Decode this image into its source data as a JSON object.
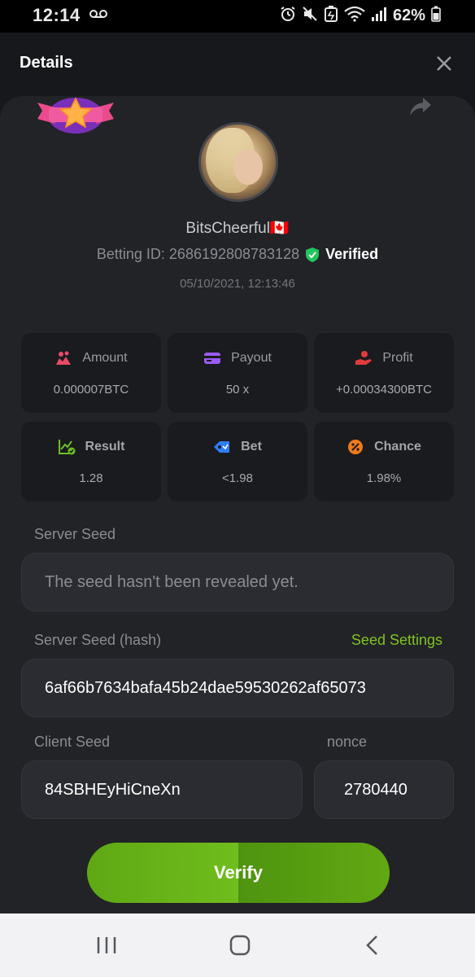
{
  "status_bar": {
    "time": "12:14",
    "voicemail_icon": "voicemail-icon",
    "battery_percent": "62%",
    "icons": [
      "alarm-icon",
      "mute-icon",
      "saver-icon",
      "wifi-icon",
      "signal-icon",
      "battery-icon"
    ]
  },
  "header": {
    "title": "Details",
    "close_icon": "close-icon"
  },
  "profile": {
    "username": "BitsCheerful🇨🇦",
    "betting_id_label": "Betting ID: 2686192808783128",
    "verified_label": "Verified",
    "datetime": "05/10/2021, 12:13:46"
  },
  "stats": [
    {
      "label": "Amount",
      "value": "0.000007BTC",
      "icon": "coins-icon",
      "color": "#e84a66"
    },
    {
      "label": "Payout",
      "value": "50 x",
      "icon": "card-icon",
      "color": "#9b5cf5"
    },
    {
      "label": "Profit",
      "value": "+0.00034300BTC",
      "icon": "hand-coin-icon",
      "color": "#e23b3b"
    },
    {
      "label": "Result",
      "value": "1.28",
      "icon": "chart-check-icon",
      "color": "#6cbf27"
    },
    {
      "label": "Bet",
      "value": "<1.98",
      "icon": "tag-icon",
      "color": "#2f7df5"
    },
    {
      "label": "Chance",
      "value": "1.98%",
      "icon": "percent-icon",
      "color": "#f07a1a"
    }
  ],
  "server_seed": {
    "label": "Server Seed",
    "value": "The seed hasn't been revealed yet."
  },
  "server_seed_hash": {
    "label": "Server Seed (hash)",
    "link": "Seed Settings",
    "value": "6af66b7634bafa45b24dae59530262af65073"
  },
  "client_seed": {
    "label": "Client Seed",
    "value": "84SBHEyHiCneXn"
  },
  "nonce": {
    "label": "nonce",
    "value": "2780440"
  },
  "verify_button": "Verify",
  "colors": {
    "accent_green": "#6fbd1d",
    "card_bg": "#222327",
    "verified_green": "#22c55e"
  }
}
